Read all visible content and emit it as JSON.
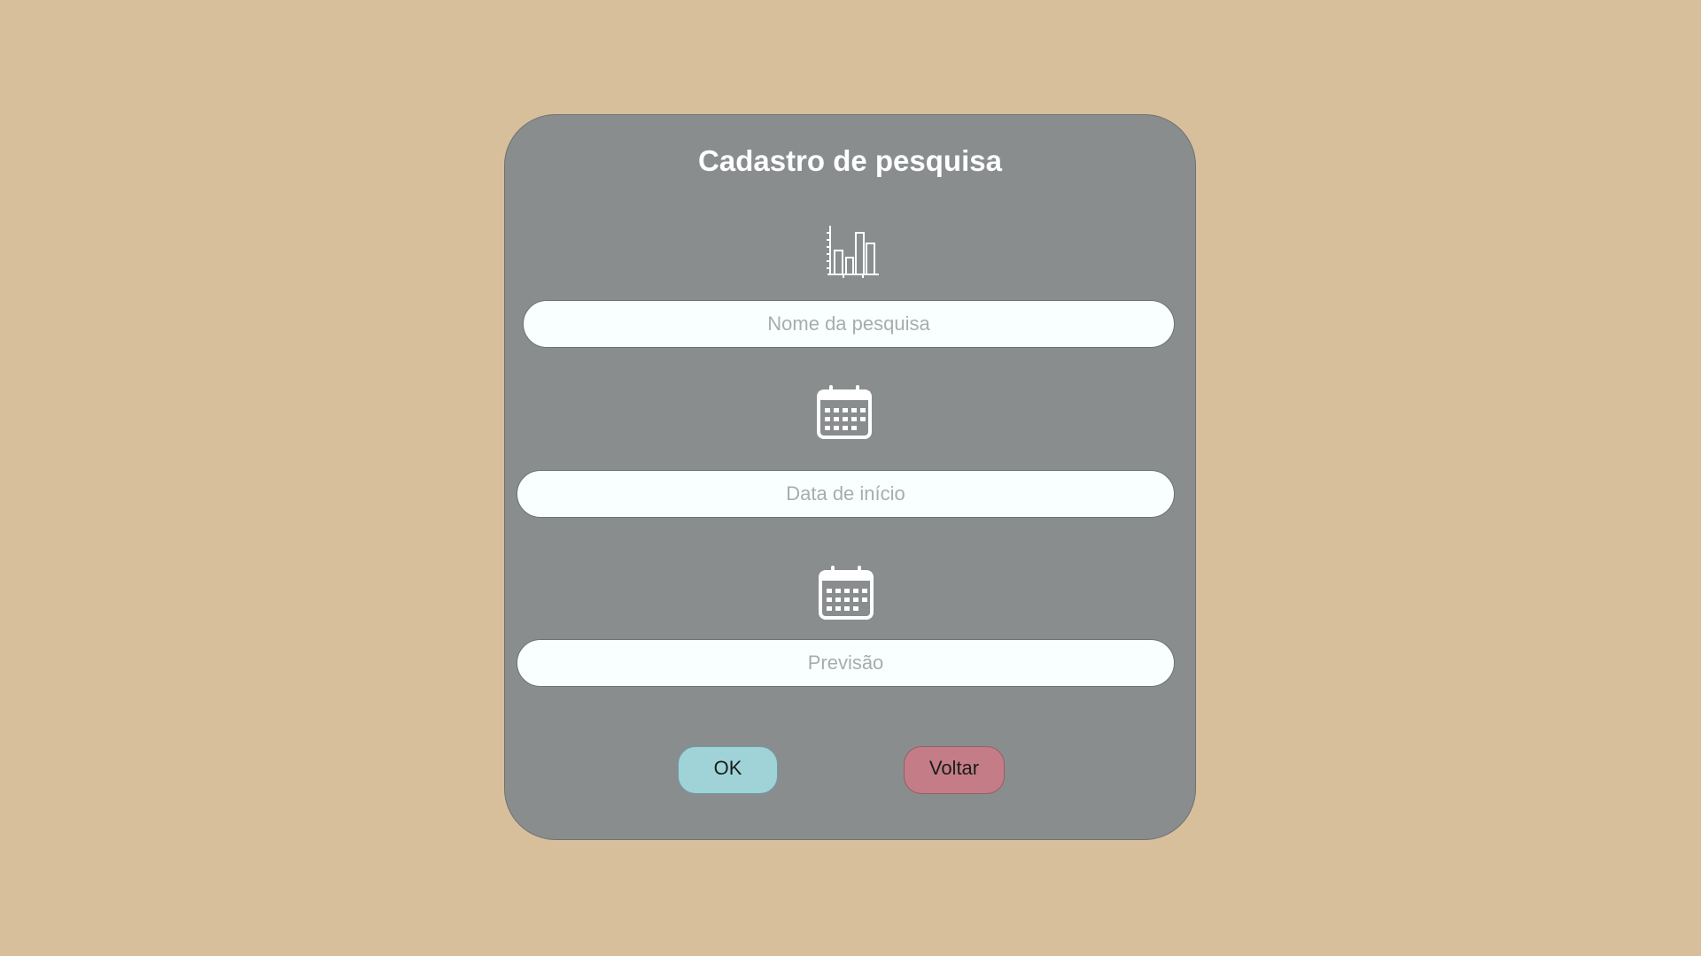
{
  "form": {
    "title": "Cadastro de pesquisa",
    "fields": [
      {
        "name": "nome",
        "placeholder": "Nome da pesquisa",
        "value": "",
        "icon": "bar-chart-icon"
      },
      {
        "name": "inicio",
        "placeholder": "Data de início",
        "value": "",
        "icon": "calendar-icon"
      },
      {
        "name": "previsao",
        "placeholder": "Previsão",
        "value": "",
        "icon": "calendar-icon"
      }
    ],
    "ok_label": "OK",
    "back_label": "Voltar"
  },
  "colors": {
    "background": "#d8bf9b",
    "card": "#8a8d8e",
    "input": "#f9feff",
    "ok_button": "#9fd3d8",
    "back_button": "#c47d86"
  }
}
